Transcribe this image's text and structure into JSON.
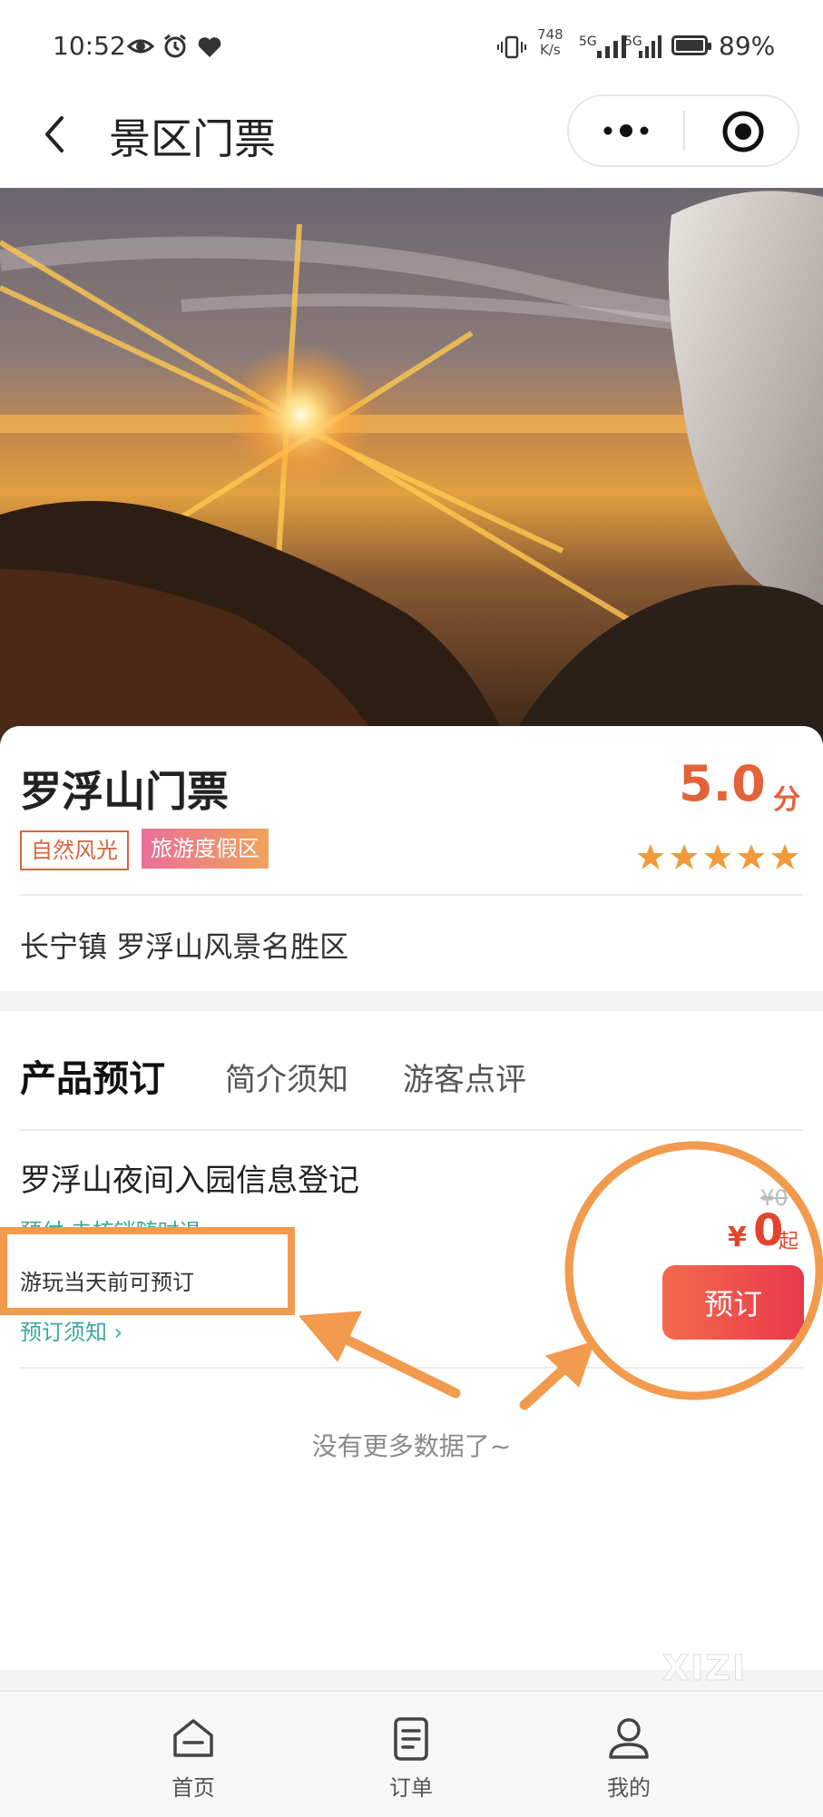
{
  "status_bar": {
    "time": "10:52",
    "net_speed_value": "748",
    "net_speed_unit": "K/s",
    "signal1": "5G",
    "signal2": "5G",
    "battery_pct": "89%"
  },
  "nav": {
    "title": "景区门票"
  },
  "spot": {
    "name": "罗浮山门票",
    "score": "5.0",
    "score_unit": "分",
    "rating": 5,
    "tags": [
      "自然风光",
      "旅游度假区"
    ],
    "address": "长宁镇 罗浮山风景名胜区"
  },
  "tabs": [
    "产品预订",
    "简介须知",
    "游客点评"
  ],
  "product": {
    "title": "罗浮山夜间入园信息登记",
    "hint_partial": "预付 未核销随时退",
    "note": "游玩当天前可预订",
    "policy_link": "预订须知 ›",
    "original_price": "¥0",
    "price_symbol": "¥",
    "price": "0",
    "price_suffix": "起",
    "book_label": "预订"
  },
  "no_more_text": "没有更多数据了~",
  "watermark": "XIZI",
  "tabbar": [
    "首页",
    "订单",
    "我的"
  ],
  "colors": {
    "accent": "#e2633a",
    "price": "#e2452e",
    "annotation": "#f29a4d",
    "teal": "#3aa9a0"
  }
}
